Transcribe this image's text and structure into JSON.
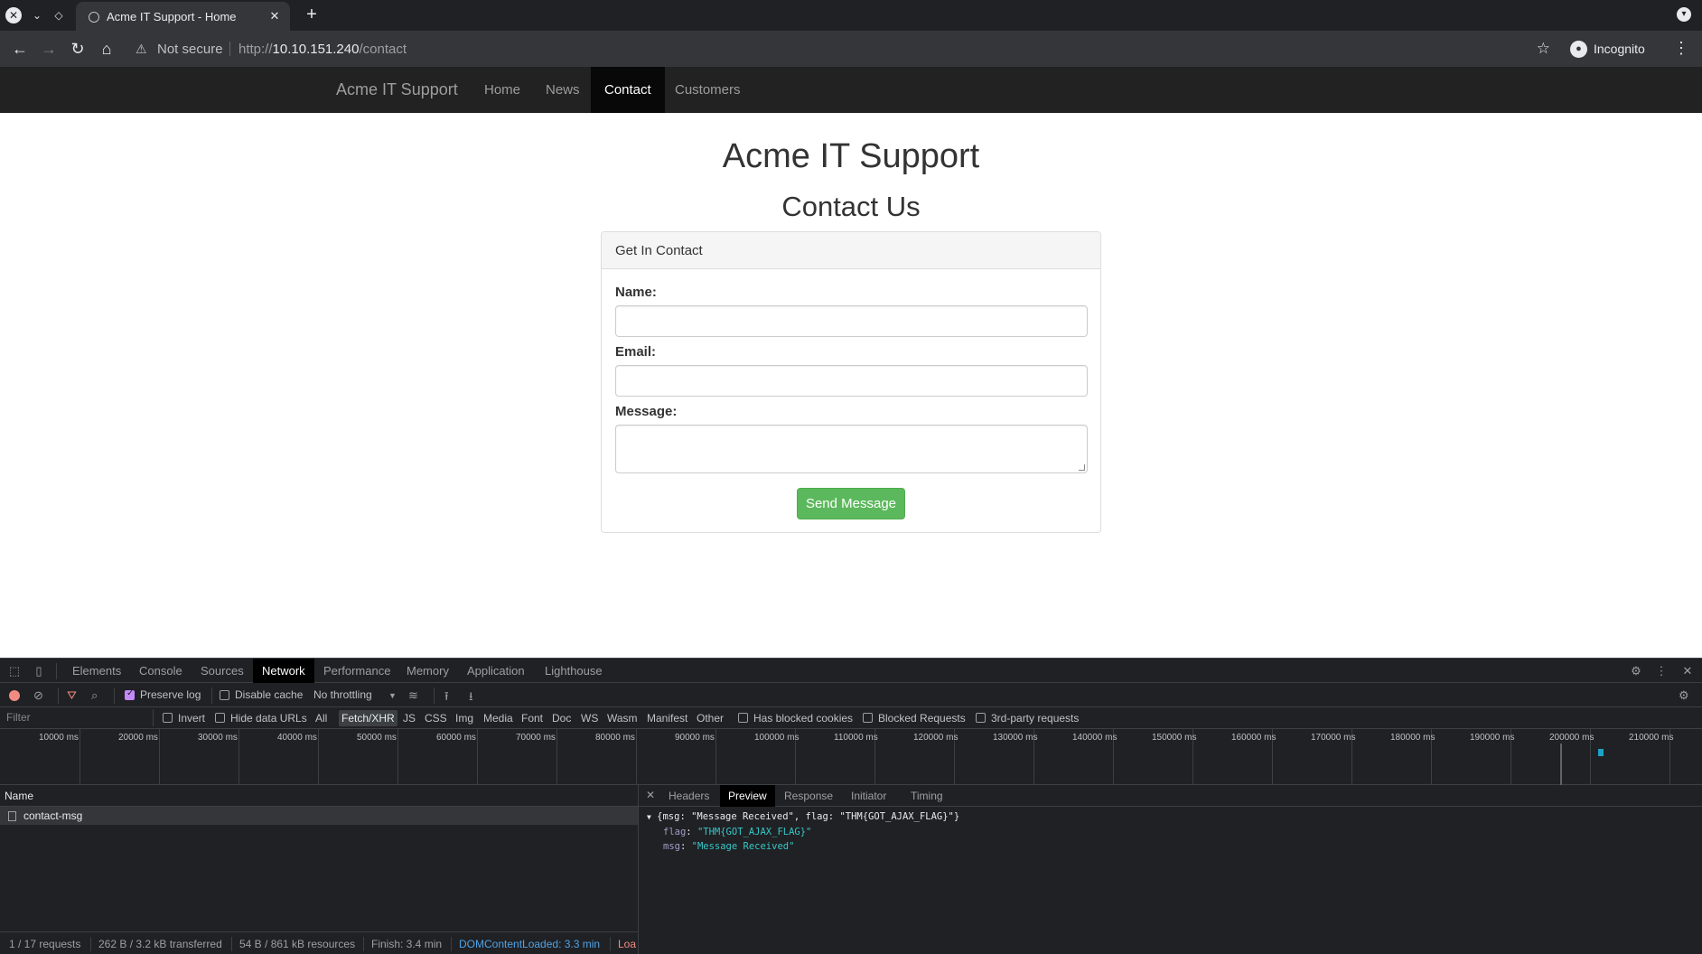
{
  "browser": {
    "tab_title": "Acme IT Support - Home",
    "omnibox": {
      "security_text": "Not secure",
      "url_scheme": "http://",
      "url_host": "10.10.151.240",
      "url_path": "/contact"
    },
    "profile_label": "Incognito"
  },
  "site": {
    "brand": "Acme IT Support",
    "nav": [
      {
        "label": "Home"
      },
      {
        "label": "News"
      },
      {
        "label": "Contact",
        "active": true
      },
      {
        "label": "Customers"
      }
    ],
    "heading": "Acme IT Support",
    "subheading": "Contact Us"
  },
  "contact_form": {
    "panel_title": "Get In Contact",
    "name_label": "Name:",
    "name_value": "",
    "email_label": "Email:",
    "email_value": "",
    "message_label": "Message:",
    "message_value": "",
    "submit_label": "Send Message"
  },
  "devtools": {
    "tabs": [
      "Elements",
      "Console",
      "Sources",
      "Network",
      "Performance",
      "Memory",
      "Application",
      "Lighthouse"
    ],
    "active_tab": "Network",
    "toolbar": {
      "preserve_log": {
        "label": "Preserve log",
        "checked": true
      },
      "disable_cache": {
        "label": "Disable cache",
        "checked": false
      },
      "throttling": "No throttling"
    },
    "filter_bar": {
      "placeholder": "Filter",
      "invert": "Invert",
      "hide_data_urls": "Hide data URLs",
      "types": [
        "All",
        "Fetch/XHR",
        "JS",
        "CSS",
        "Img",
        "Media",
        "Font",
        "Doc",
        "WS",
        "Wasm",
        "Manifest",
        "Other"
      ],
      "selected_type": "Fetch/XHR",
      "has_blocked_cookies": "Has blocked cookies",
      "blocked_requests": "Blocked Requests",
      "third_party": "3rd-party requests"
    },
    "timeline_ticks": [
      "10000 ms",
      "20000 ms",
      "30000 ms",
      "40000 ms",
      "50000 ms",
      "60000 ms",
      "70000 ms",
      "80000 ms",
      "90000 ms",
      "100000 ms",
      "110000 ms",
      "120000 ms",
      "130000 ms",
      "140000 ms",
      "150000 ms",
      "160000 ms",
      "170000 ms",
      "180000 ms",
      "190000 ms",
      "200000 ms",
      "210000 ms"
    ],
    "requests_header": "Name",
    "requests": [
      {
        "name": "contact-msg"
      }
    ],
    "detail_tabs": [
      "Headers",
      "Preview",
      "Response",
      "Initiator",
      "Timing"
    ],
    "active_detail_tab": "Preview",
    "preview": {
      "summary": "{msg: \"Message Received\", flag: \"THM{GOT_AJAX_FLAG}\"}",
      "flag_key": "flag",
      "flag_value": "\"THM{GOT_AJAX_FLAG}\"",
      "msg_key": "msg",
      "msg_value": "\"Message Received\""
    },
    "status": {
      "requests": "1 / 17 requests",
      "transferred": "262 B / 3.2 kB transferred",
      "resources": "54 B / 861 kB resources",
      "finish": "Finish: 3.4 min",
      "dom_content_loaded": "DOMContentLoaded: 3.3 min",
      "load": "Loa"
    }
  }
}
